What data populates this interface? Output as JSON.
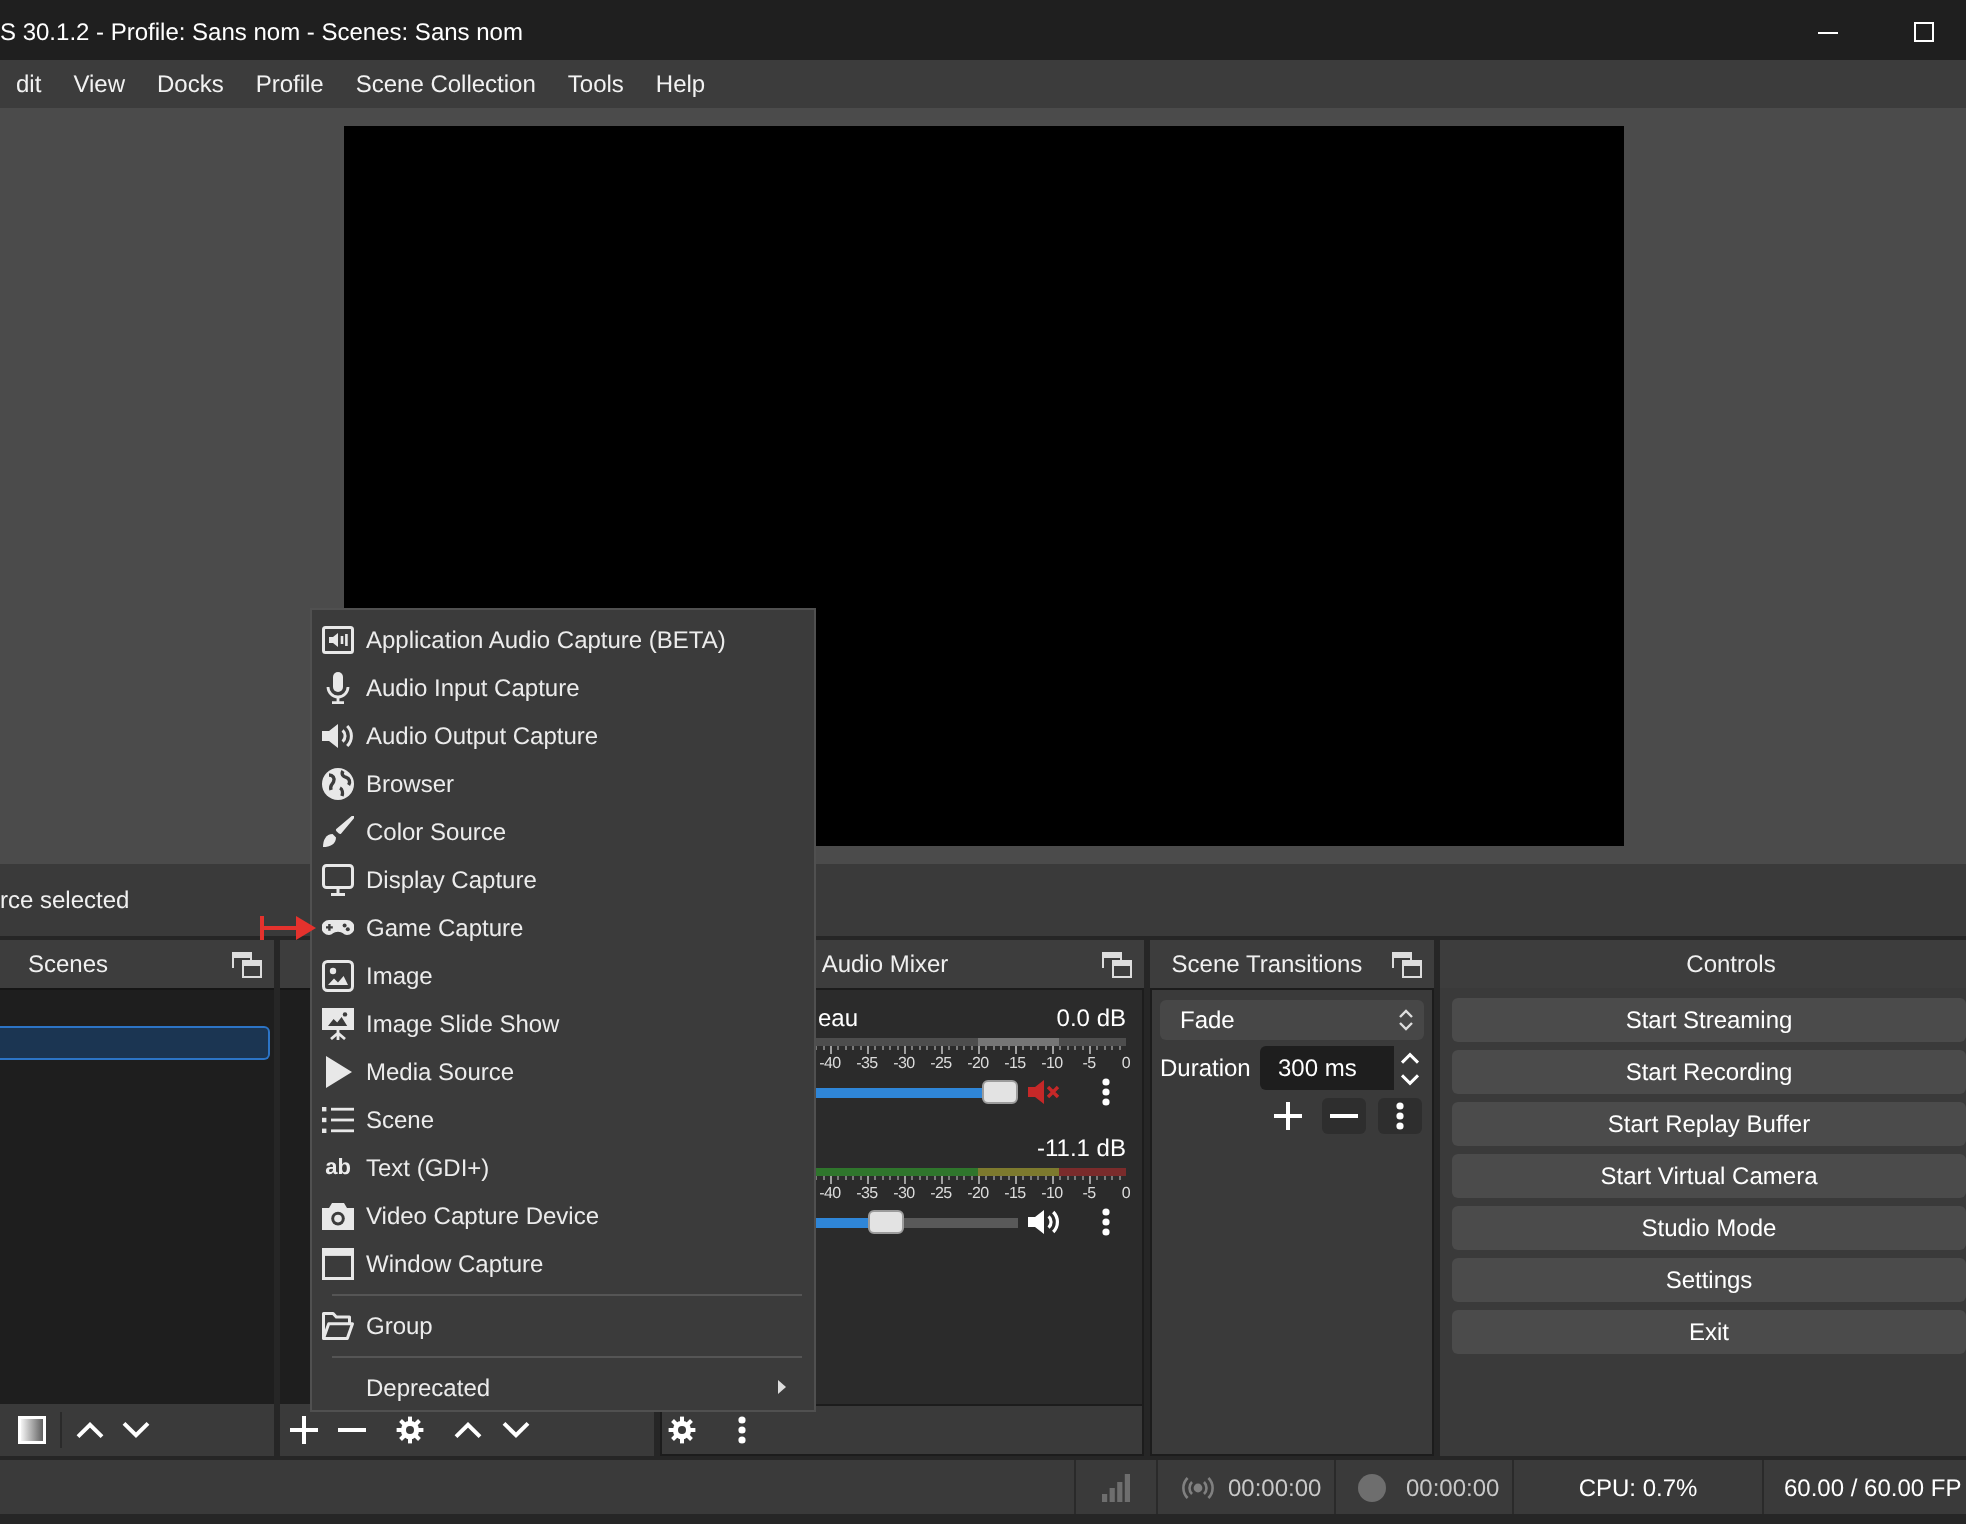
{
  "window": {
    "title": "S 30.1.2 - Profile: Sans nom - Scenes: Sans nom"
  },
  "menu_bar": [
    "dit",
    "View",
    "Docks",
    "Profile",
    "Scene Collection",
    "Tools",
    "Help"
  ],
  "source_bar": {
    "message": "rce selected"
  },
  "scenes": {
    "title": "Scenes",
    "items": [
      {
        "selected": true
      }
    ]
  },
  "audio_mixer": {
    "title": "Audio Mixer",
    "channels": [
      {
        "name": "eau",
        "reading": "0.0 dB",
        "muted": true,
        "level": 1,
        "scale": [
          "-40",
          "-35",
          "-30",
          "-25",
          "-20",
          "-15",
          "-10",
          "-5",
          "0"
        ]
      },
      {
        "reading": "-11.1 dB",
        "muted": false,
        "level": 0.62,
        "scale": [
          "-40",
          "-35",
          "-30",
          "-25",
          "-20",
          "-15",
          "-10",
          "-5",
          "0"
        ]
      }
    ]
  },
  "scene_transitions": {
    "title": "Scene Transitions",
    "transition": "Fade",
    "duration_label": "Duration",
    "duration": "300 ms"
  },
  "controls": {
    "title": "Controls",
    "buttons": [
      "Start Streaming",
      "Start Recording",
      "Start Replay Buffer",
      "Start Virtual Camera",
      "Studio Mode",
      "Settings",
      "Exit"
    ]
  },
  "status_bar": {
    "stream_time": "00:00:00",
    "record_time": "00:00:00",
    "cpu": "CPU: 0.7%",
    "fps": "60.00 / 60.00 FP"
  },
  "add_source_menu": {
    "sections": [
      {
        "items": [
          {
            "label": "Application Audio Capture (BETA)",
            "submenu": false
          },
          {
            "label": "Audio Input Capture",
            "submenu": false
          },
          {
            "label": "Audio Output Capture",
            "submenu": false
          },
          {
            "label": "Browser",
            "submenu": false
          },
          {
            "label": "Color Source",
            "submenu": false
          },
          {
            "label": "Display Capture",
            "submenu": false
          },
          {
            "label": "Game Capture",
            "submenu": false
          },
          {
            "label": "Image",
            "submenu": false
          },
          {
            "label": "Image Slide Show",
            "submenu": false
          },
          {
            "label": "Media Source",
            "submenu": false
          },
          {
            "label": "Scene",
            "submenu": false
          },
          {
            "label": "Text (GDI+)",
            "glyph": "ab",
            "submenu": false
          },
          {
            "label": "Video Capture Device",
            "submenu": false
          },
          {
            "label": "Window Capture",
            "submenu": false
          }
        ]
      },
      {
        "items": [
          {
            "label": "Group",
            "submenu": false
          }
        ]
      },
      {
        "items": [
          {
            "label": "Deprecated",
            "submenu": true
          }
        ]
      }
    ]
  }
}
